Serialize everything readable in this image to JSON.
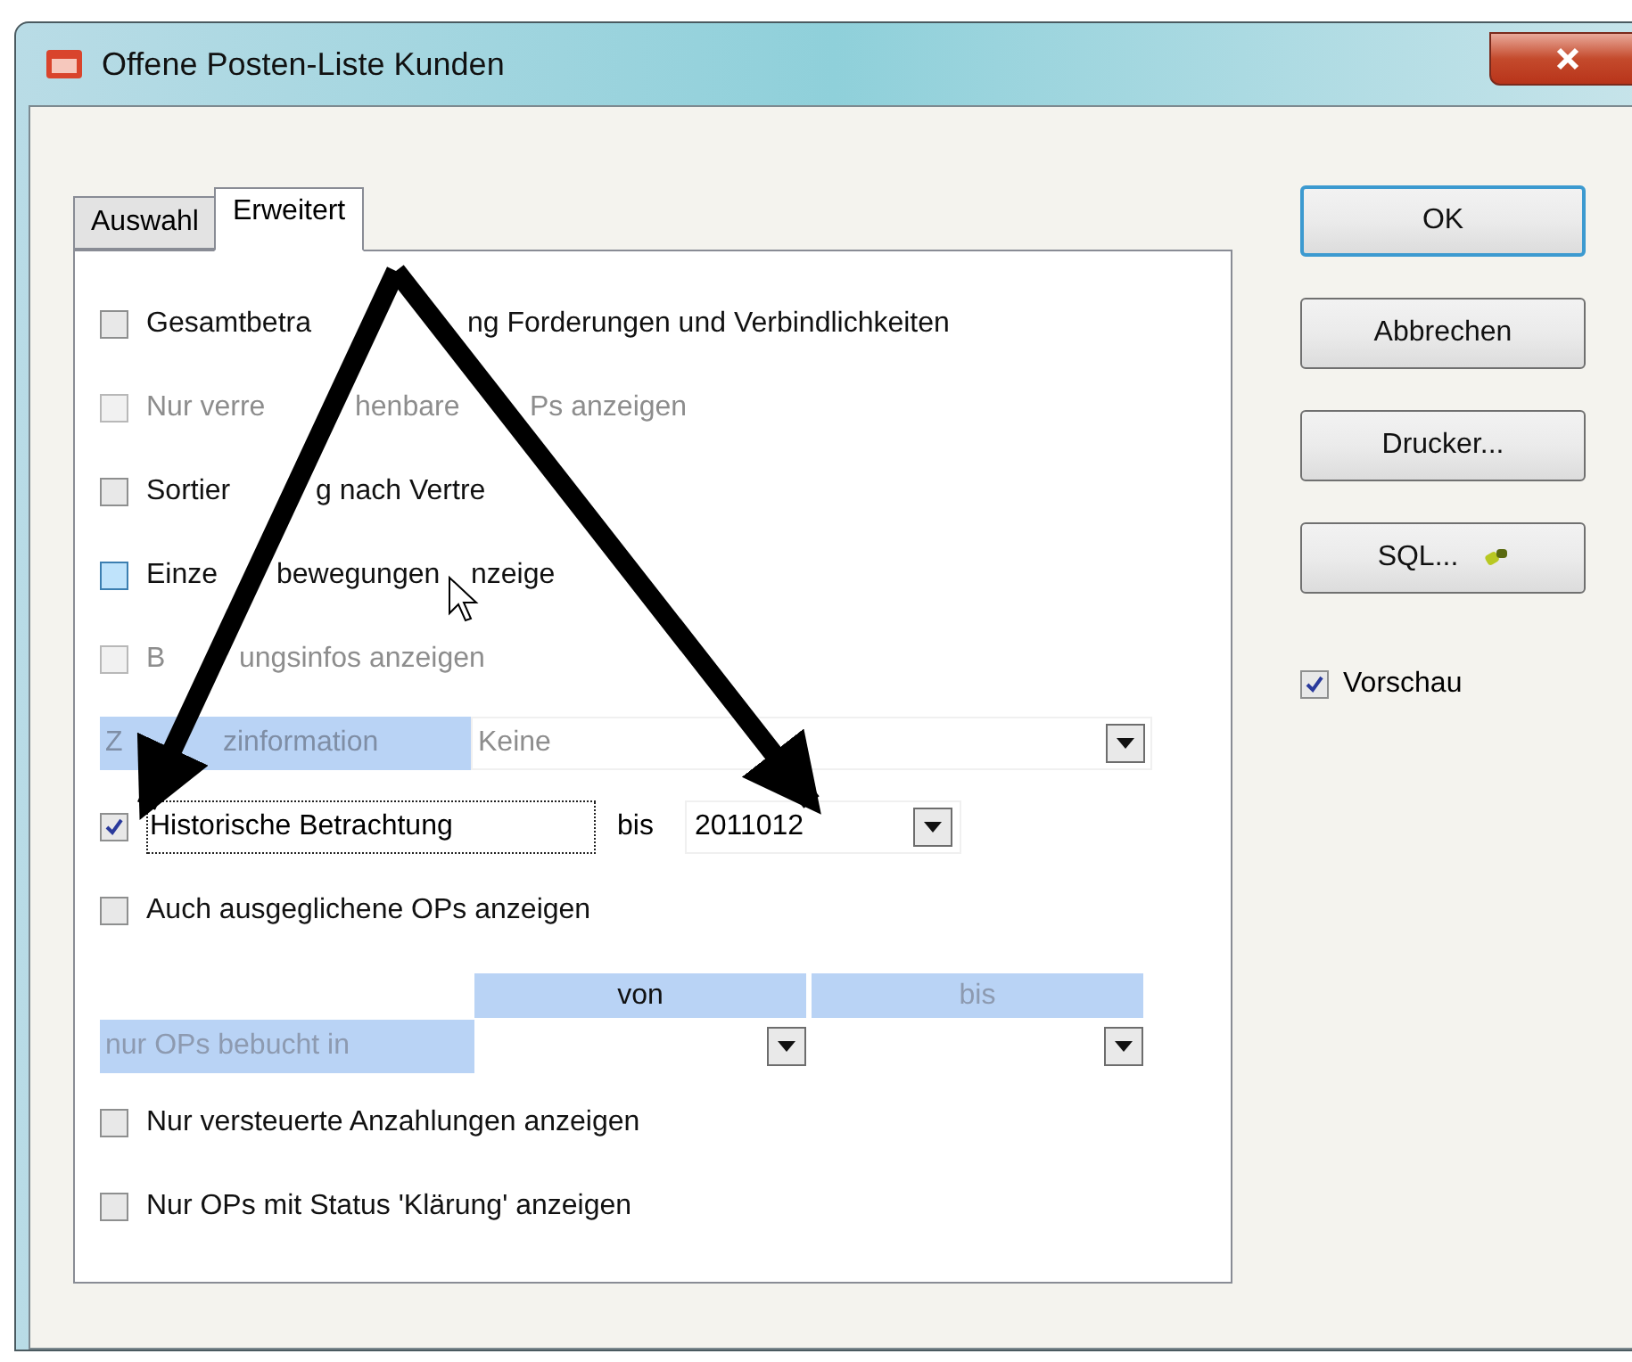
{
  "window": {
    "title": "Offene Posten-Liste Kunden"
  },
  "tabs": [
    {
      "label": "Auswahl",
      "selected": false
    },
    {
      "label": "Erweitert",
      "selected": true
    }
  ],
  "options": [
    {
      "kind": "checkbox",
      "label_parts": [
        "Gesamtbetra",
        "ng Forderungen und Verbindlichkeiten"
      ],
      "checked": false,
      "disabled": false,
      "hot": false
    },
    {
      "kind": "checkbox",
      "label_parts": [
        "Nur verre",
        "henbare",
        "Ps anzeigen"
      ],
      "checked": false,
      "disabled": true,
      "hot": false
    },
    {
      "kind": "checkbox",
      "label_parts": [
        "Sortier",
        "g nach Vertre"
      ],
      "checked": false,
      "disabled": false,
      "hot": false
    },
    {
      "kind": "checkbox",
      "label_parts": [
        "Einze",
        "bewegungen",
        "nzeige"
      ],
      "checked": false,
      "disabled": false,
      "hot": true
    },
    {
      "kind": "checkbox",
      "label_parts": [
        "B",
        "ungsinfos anzeigen"
      ],
      "checked": false,
      "disabled": true,
      "hot": false
    },
    {
      "kind": "combo",
      "label_parts": [
        "Z",
        "zinformation"
      ],
      "value": "Keine",
      "disabled": true
    },
    {
      "kind": "history",
      "label": "Historische Betrachtung",
      "checked": true,
      "focused": true,
      "connector": "bis",
      "value": "2011012"
    },
    {
      "kind": "checkbox",
      "label_parts": [
        "Auch ausgeglichene OPs anzeigen"
      ],
      "checked": false,
      "disabled": false,
      "hot": false
    },
    {
      "kind": "range",
      "label": "nur OPs bebucht in",
      "headers": [
        {
          "text": "von",
          "disabled": false
        },
        {
          "text": "bis",
          "disabled": true
        }
      ]
    },
    {
      "kind": "checkbox",
      "label_parts": [
        "Nur versteuerte Anzahlungen anzeigen"
      ],
      "checked": false,
      "disabled": false,
      "hot": false
    },
    {
      "kind": "checkbox",
      "label_parts": [
        "Nur OPs mit Status 'Klärung' anzeigen"
      ],
      "checked": false,
      "disabled": false,
      "hot": false
    }
  ],
  "buttons": [
    {
      "label": "OK",
      "default": true,
      "icon": false
    },
    {
      "label": "Abbrechen",
      "default": false,
      "icon": false
    },
    {
      "label": "Drucker...",
      "default": false,
      "icon": false
    },
    {
      "label": "SQL...",
      "default": false,
      "icon": true
    }
  ],
  "preview": {
    "label": "Vorschau",
    "checked": true
  }
}
